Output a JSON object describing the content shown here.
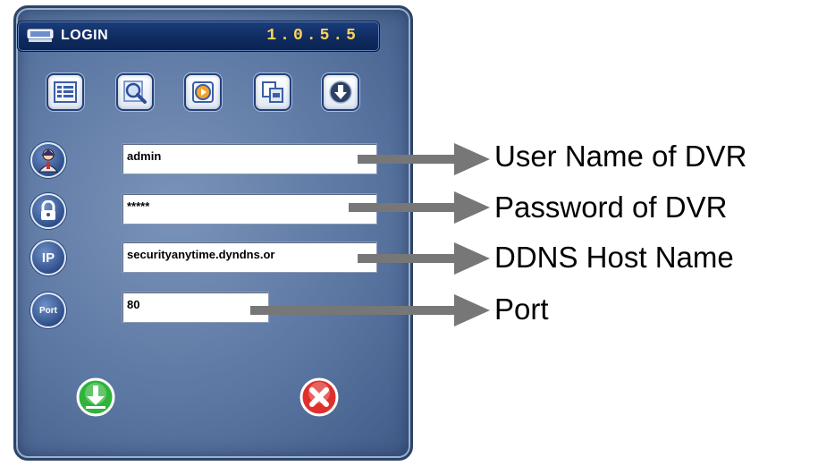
{
  "window": {
    "title": "LOGIN",
    "version": "1.0.5.5",
    "title_icon": "monitor-icon"
  },
  "toolbar": {
    "buttons": [
      {
        "icon": "list-icon"
      },
      {
        "icon": "search-icon"
      },
      {
        "icon": "playback-icon"
      },
      {
        "icon": "copy-icon"
      },
      {
        "icon": "download-icon"
      }
    ]
  },
  "form": {
    "username": {
      "icon": "user-icon",
      "value": "admin"
    },
    "password": {
      "icon": "lock-icon",
      "value": "*****"
    },
    "host": {
      "icon": "ip-icon",
      "icon_text": "IP",
      "value": "securityanytime.dyndns.or"
    },
    "port": {
      "icon": "port-icon",
      "icon_text": "Port",
      "value": "80"
    }
  },
  "actions": {
    "ok_icon": "confirm-icon",
    "cancel_icon": "close-icon"
  },
  "callouts": {
    "username": "User Name of DVR",
    "password": "Password of DVR",
    "host": "DDNS Host Name",
    "port": "Port"
  },
  "colors": {
    "panel": "#5b77a2",
    "titlebar": "#0e2a5e",
    "version": "#ffd45a",
    "arrow": "#777777",
    "ok": "#2fb33a",
    "cancel": "#e0302c"
  }
}
